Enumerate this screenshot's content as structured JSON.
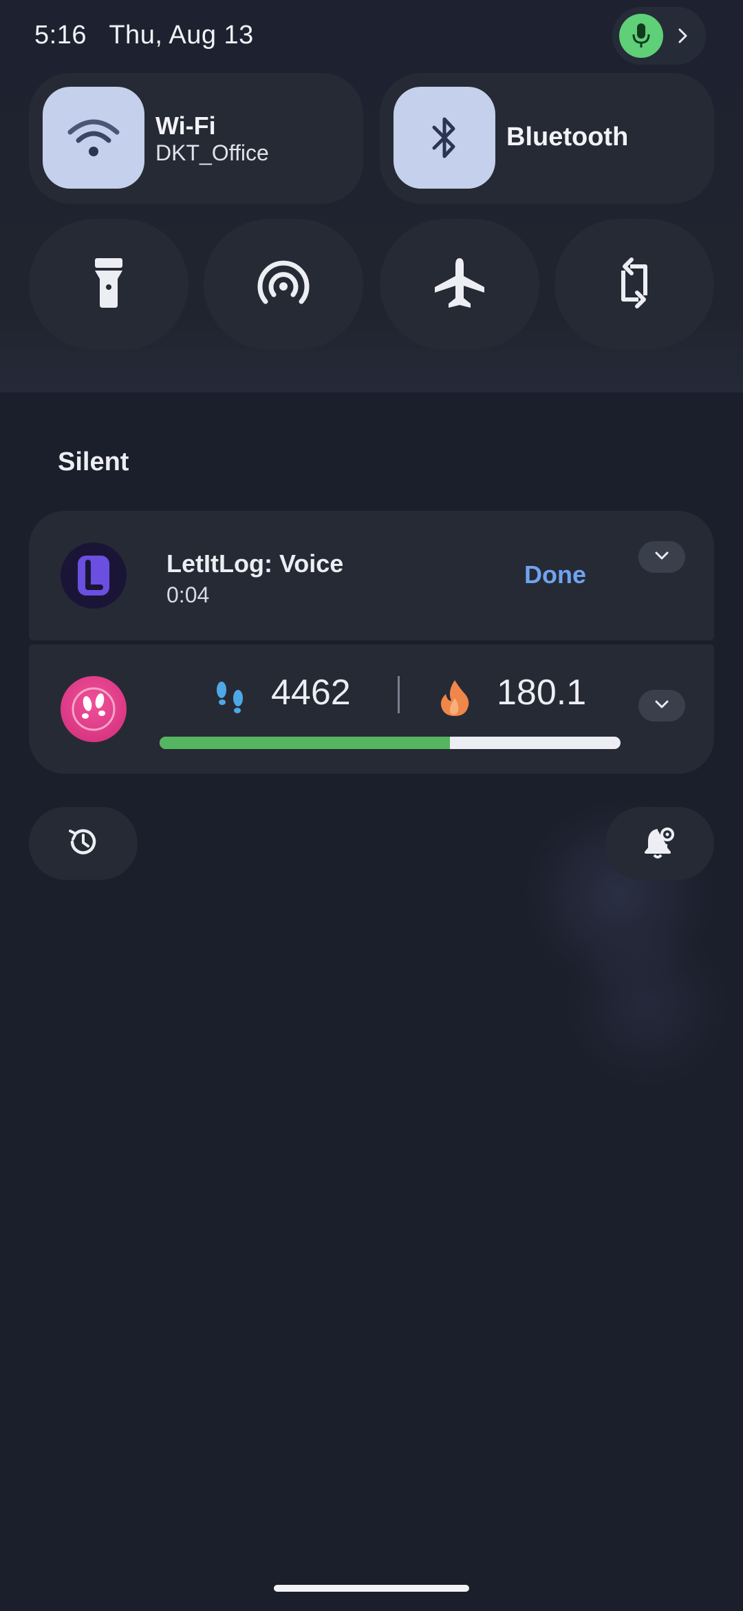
{
  "status_bar": {
    "time": "5:16",
    "date": "Thu, Aug 13",
    "mic_icon": "mic-icon",
    "chevron_icon": "chevron-right-icon",
    "mic_color": "#5fcf78"
  },
  "quick_settings": {
    "wifi": {
      "label": "Wi-Fi",
      "network": "DKT_Office",
      "icon": "wifi-icon"
    },
    "bluetooth": {
      "label": "Bluetooth",
      "icon": "bluetooth-icon"
    },
    "round_tiles": [
      {
        "name": "flashlight",
        "icon": "flashlight-icon"
      },
      {
        "name": "hotspot",
        "icon": "hotspot-icon"
      },
      {
        "name": "airplane-mode",
        "icon": "airplane-icon"
      },
      {
        "name": "auto-rotate",
        "icon": "rotate-icon"
      }
    ]
  },
  "notifications": {
    "section_title": "Silent",
    "items": [
      {
        "app": "LetItLog",
        "title": "LetItLog: Voice",
        "subtitle": "0:04",
        "action": "Done",
        "icon_letter": "L"
      },
      {
        "app": "Steps",
        "steps": "4462",
        "calories": "180.1",
        "progress_fraction": 0.63,
        "progress_color": "#56b560"
      }
    ]
  },
  "bottom_buttons": {
    "history_icon": "history-icon",
    "settings_icon": "notification-settings-icon"
  },
  "colors": {
    "background": "#1b1f2b",
    "tile": "#262a35",
    "tile_active": "#c5d0ec",
    "accent_blue": "#6fa4ee"
  }
}
